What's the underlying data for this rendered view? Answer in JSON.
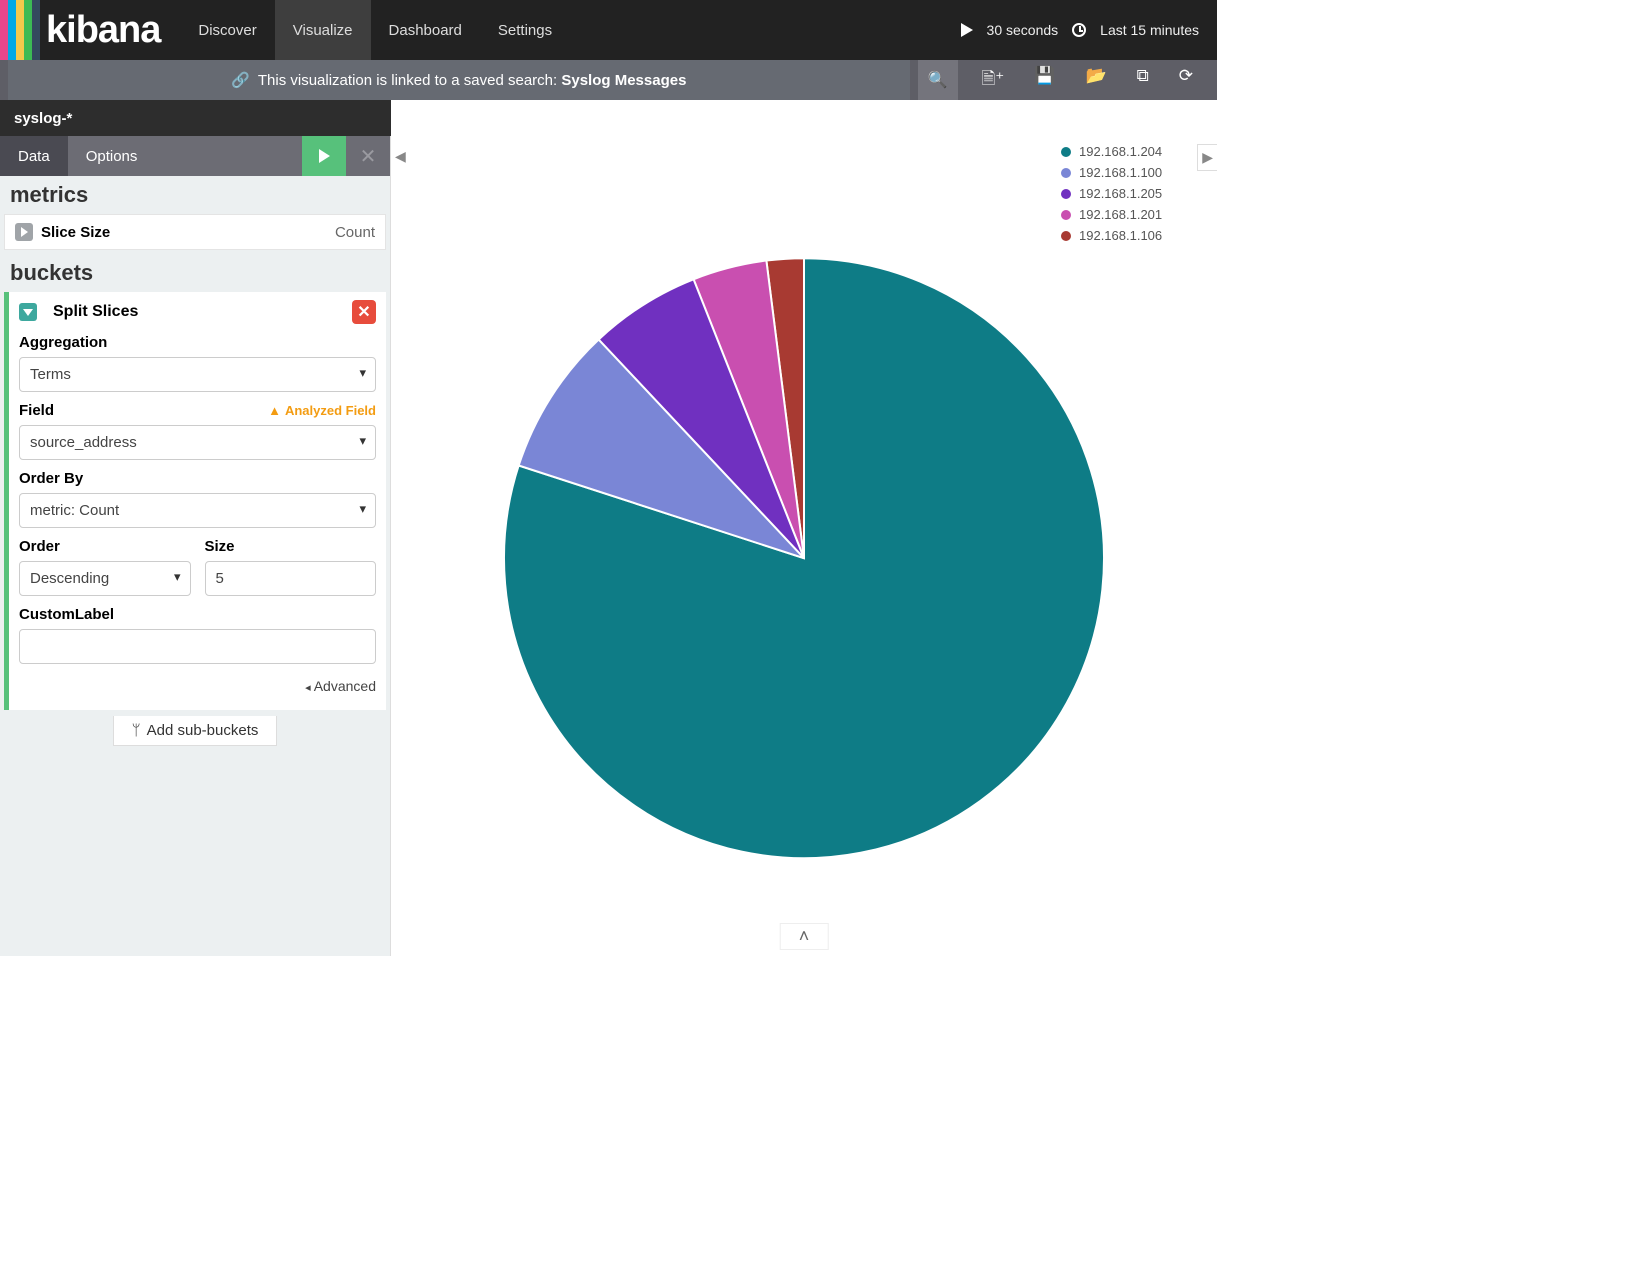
{
  "brand": "kibana",
  "logo_stripes": [
    "#e8478b",
    "#00a9e5",
    "#f2c94c",
    "#3cba54",
    "#34495e"
  ],
  "nav": {
    "items": [
      "Discover",
      "Visualize",
      "Dashboard",
      "Settings"
    ],
    "active_index": 1
  },
  "refresh_interval": "30 seconds",
  "time_range": "Last 15 minutes",
  "linked_search_msg_prefix": "This visualization is linked to a saved search: ",
  "linked_search_name": "Syslog Messages",
  "index_pattern": "syslog-*",
  "panel_tabs": {
    "items": [
      "Data",
      "Options"
    ],
    "active_index": 0
  },
  "metrics": {
    "heading": "metrics",
    "row_label": "Slice Size",
    "row_value": "Count"
  },
  "buckets": {
    "heading": "buckets",
    "split_label": "Split Slices",
    "aggregation": {
      "label": "Aggregation",
      "value": "Terms"
    },
    "field": {
      "label": "Field",
      "value": "source_address",
      "analyzed_warning": "Analyzed Field"
    },
    "order_by": {
      "label": "Order By",
      "value": "metric: Count"
    },
    "order": {
      "label": "Order",
      "value": "Descending"
    },
    "size": {
      "label": "Size",
      "value": "5"
    },
    "custom_label": {
      "label": "CustomLabel",
      "value": ""
    },
    "advanced": "Advanced",
    "add_sub": "Add sub-buckets"
  },
  "legend": [
    {
      "label": "192.168.1.204",
      "color": "#0e7c86"
    },
    {
      "label": "192.168.1.100",
      "color": "#7a86d6"
    },
    {
      "label": "192.168.1.205",
      "color": "#7030c0"
    },
    {
      "label": "192.168.1.201",
      "color": "#c94fb0"
    },
    {
      "label": "192.168.1.106",
      "color": "#a83a32"
    }
  ],
  "chart_data": {
    "type": "pie",
    "title": "",
    "series": [
      {
        "name": "192.168.1.204",
        "value": 80,
        "color": "#0e7c86"
      },
      {
        "name": "192.168.1.100",
        "value": 8,
        "color": "#7a86d6"
      },
      {
        "name": "192.168.1.205",
        "value": 6,
        "color": "#7030c0"
      },
      {
        "name": "192.168.1.201",
        "value": 4,
        "color": "#c94fb0"
      },
      {
        "name": "192.168.1.106",
        "value": 2,
        "color": "#a83a32"
      }
    ]
  }
}
